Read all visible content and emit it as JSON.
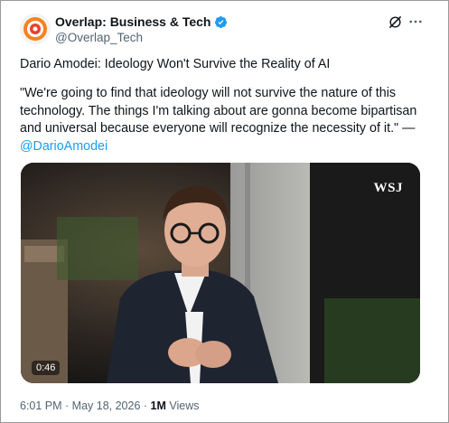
{
  "author": {
    "name": "Overlap: Business & Tech",
    "handle": "@Overlap_Tech",
    "avatar_icon": "overlap-logo-icon",
    "verified_icon": "verified-badge-icon"
  },
  "post": {
    "title": "Dario Amodei: Ideology Won't Survive the Reality of AI",
    "quote": "\"We're going to find that ideology will not survive the nature of this technology. The things I'm talking about are gonna become bipartisan and universal because everyone will recognize the necessity of it.\" —",
    "mention": "@DarioAmodei"
  },
  "media": {
    "watermark": "WSJ",
    "duration": "0:46"
  },
  "meta": {
    "time_date": "6:01 PM · May 18, 2026 · ",
    "views_count": "1M",
    "views_label": " Views"
  },
  "icons": {
    "grok": "grok-icon",
    "more": "more-icon"
  },
  "colors": {
    "accent": "#1d9bf0",
    "text": "#0f1419",
    "secondary": "#536471"
  }
}
